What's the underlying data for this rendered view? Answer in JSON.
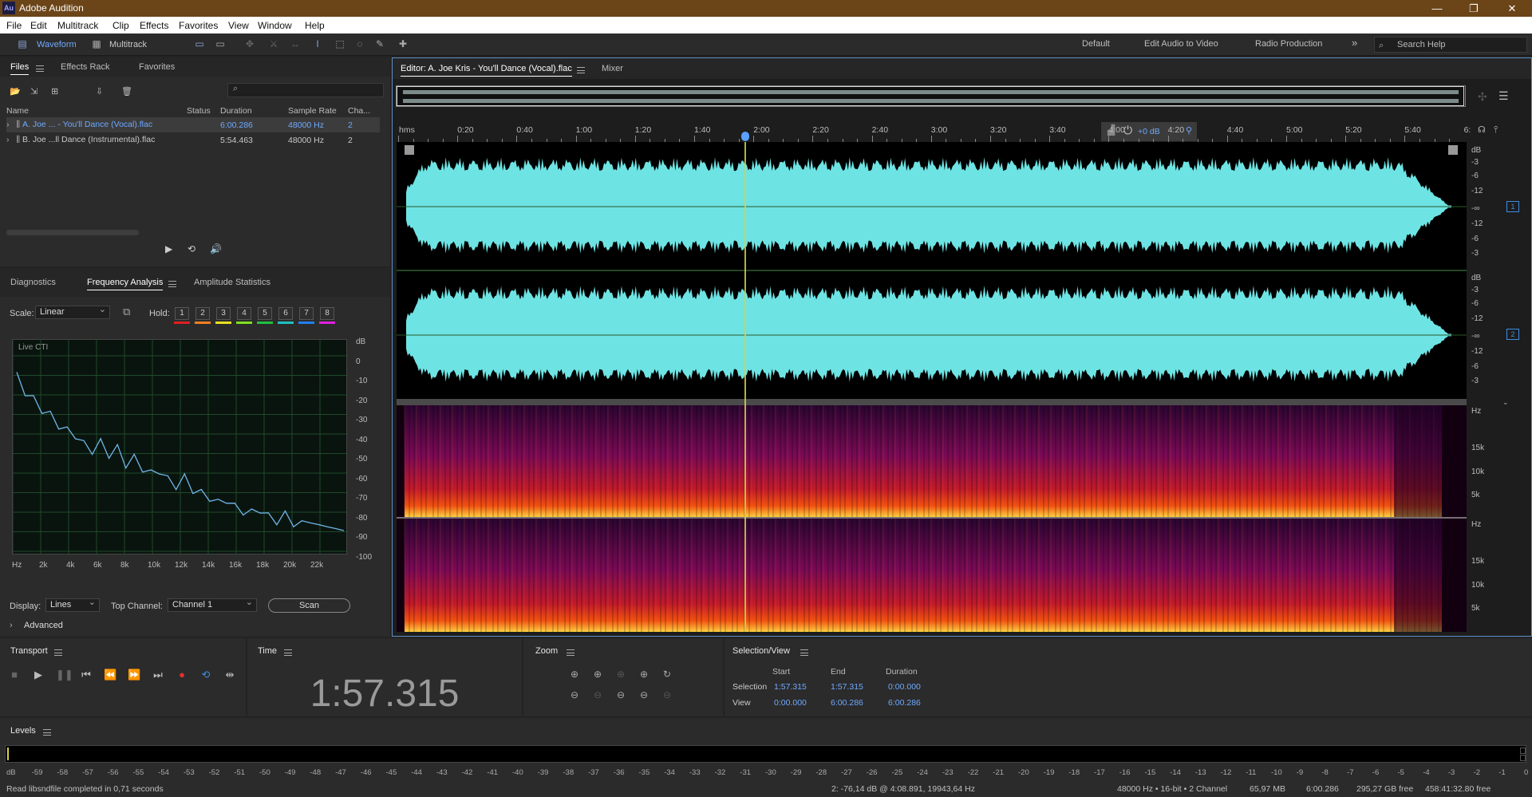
{
  "app": {
    "title": "Adobe Audition",
    "logo": "Au"
  },
  "menu": [
    "File",
    "Edit",
    "Multitrack",
    "Clip",
    "Effects",
    "Favorites",
    "View",
    "Window",
    "Help"
  ],
  "toolbar": {
    "waveform": "Waveform",
    "multitrack": "Multitrack",
    "workspaces": [
      "Default",
      "Edit Audio to Video",
      "Radio Production"
    ],
    "search_placeholder": "Search Help"
  },
  "files": {
    "tabs": [
      "Files",
      "Effects Rack",
      "Favorites"
    ],
    "columns": [
      "Name",
      "Status",
      "Duration",
      "Sample Rate",
      "Cha..."
    ],
    "rows": [
      {
        "name": "A. Joe ... - You'll Dance (Vocal).flac",
        "status": "",
        "duration": "6:00.286",
        "rate": "48000 Hz",
        "ch": "2"
      },
      {
        "name": "B. Joe ...ll Dance (Instrumental).flac",
        "status": "",
        "duration": "5:54.463",
        "rate": "48000 Hz",
        "ch": "2"
      }
    ]
  },
  "analysis": {
    "tabs": [
      "Diagnostics",
      "Frequency Analysis",
      "Amplitude Statistics"
    ],
    "scale_label": "Scale:",
    "scale_value": "Linear",
    "hold_label": "Hold:",
    "hold": [
      "1",
      "2",
      "3",
      "4",
      "5",
      "6",
      "7",
      "8"
    ],
    "hold_colors": [
      "#e02020",
      "#f08020",
      "#e8e020",
      "#80e020",
      "#20c040",
      "#20c0c0",
      "#2080f0",
      "#e020e0"
    ],
    "plot_label": "Live CTI",
    "yticks": [
      "dB",
      "0",
      "-10",
      "-20",
      "-30",
      "-40",
      "-50",
      "-60",
      "-70",
      "-80",
      "-90",
      "-100"
    ],
    "xticks": [
      "Hz",
      "2k",
      "4k",
      "6k",
      "8k",
      "10k",
      "12k",
      "14k",
      "16k",
      "18k",
      "20k",
      "22k"
    ],
    "display_label": "Display:",
    "display_value": "Lines",
    "topch_label": "Top Channel:",
    "topch_value": "Channel 1",
    "scan": "Scan",
    "advanced": "Advanced",
    "spectrum_db": [
      -10,
      -18,
      -22,
      -27,
      -30,
      -35,
      -38,
      -40,
      -45,
      -48,
      -44,
      -50,
      -47,
      -55,
      -52,
      -57,
      -60,
      -58,
      -63,
      -66,
      -62,
      -68,
      -70,
      -72,
      -75,
      -73,
      -77,
      -79,
      -80,
      -78,
      -82,
      -84,
      -81,
      -85,
      -86,
      -83,
      -88,
      -85,
      -90,
      -87
    ]
  },
  "editor": {
    "tab_editor": "Editor: A. Joe Kris - You'll Dance (Vocal).flac",
    "tab_mixer": "Mixer",
    "time_labels": [
      "hms",
      "0:20",
      "0:40",
      "1:00",
      "1:20",
      "1:40",
      "2:00",
      "2:20",
      "2:40",
      "3:00",
      "3:20",
      "3:40",
      "4:00",
      "4:20",
      "4:40",
      "5:00",
      "5:20",
      "5:40",
      "6:"
    ],
    "gain": "+0 dB",
    "db_scale": [
      "dB",
      "-3",
      "-6",
      "-12",
      "-∞",
      "-12",
      "-6",
      "-3"
    ],
    "ch1": "1",
    "ch2": "2",
    "hz_labels": [
      "Hz",
      "15k",
      "10k",
      "5k"
    ],
    "playhead": "2:00"
  },
  "transport": {
    "title": "Transport"
  },
  "time": {
    "title": "Time",
    "value": "1:57.315"
  },
  "zoom": {
    "title": "Zoom"
  },
  "selection": {
    "title": "Selection/View",
    "headers": [
      "Start",
      "End",
      "Duration"
    ],
    "rows": [
      {
        "label": "Selection",
        "start": "1:57.315",
        "end": "1:57.315",
        "duration": "0:00.000"
      },
      {
        "label": "View",
        "start": "0:00.000",
        "end": "6:00.286",
        "duration": "6:00.286"
      }
    ]
  },
  "levels": {
    "title": "Levels",
    "ticks": [
      "dB",
      "-59",
      "-58",
      "-57",
      "-56",
      "-55",
      "-54",
      "-53",
      "-52",
      "-51",
      "-50",
      "-49",
      "-48",
      "-47",
      "-46",
      "-45",
      "-44",
      "-43",
      "-42",
      "-41",
      "-40",
      "-39",
      "-38",
      "-37",
      "-36",
      "-35",
      "-34",
      "-33",
      "-32",
      "-31",
      "-30",
      "-29",
      "-28",
      "-27",
      "-26",
      "-25",
      "-24",
      "-23",
      "-22",
      "-21",
      "-20",
      "-19",
      "-18",
      "-17",
      "-16",
      "-15",
      "-14",
      "-13",
      "-12",
      "-11",
      "-10",
      "-9",
      "-8",
      "-7",
      "-6",
      "-5",
      "-4",
      "-3",
      "-2",
      "-1",
      "0"
    ]
  },
  "status": {
    "left": "Read libsndfile completed in 0,71 seconds",
    "cursor": "2: -76,14 dB @ 4:08.891, 19943,64 Hz",
    "format": "48000 Hz • 16-bit • 2 Channel",
    "size": "65,97 MB",
    "duration": "6:00.286",
    "free": "295,27 GB free",
    "free_time": "458:41:32.80 free"
  },
  "colors": {
    "waveform": "#6ee3e3",
    "accent": "#3f8de0",
    "titlebar": "#6b4518"
  }
}
